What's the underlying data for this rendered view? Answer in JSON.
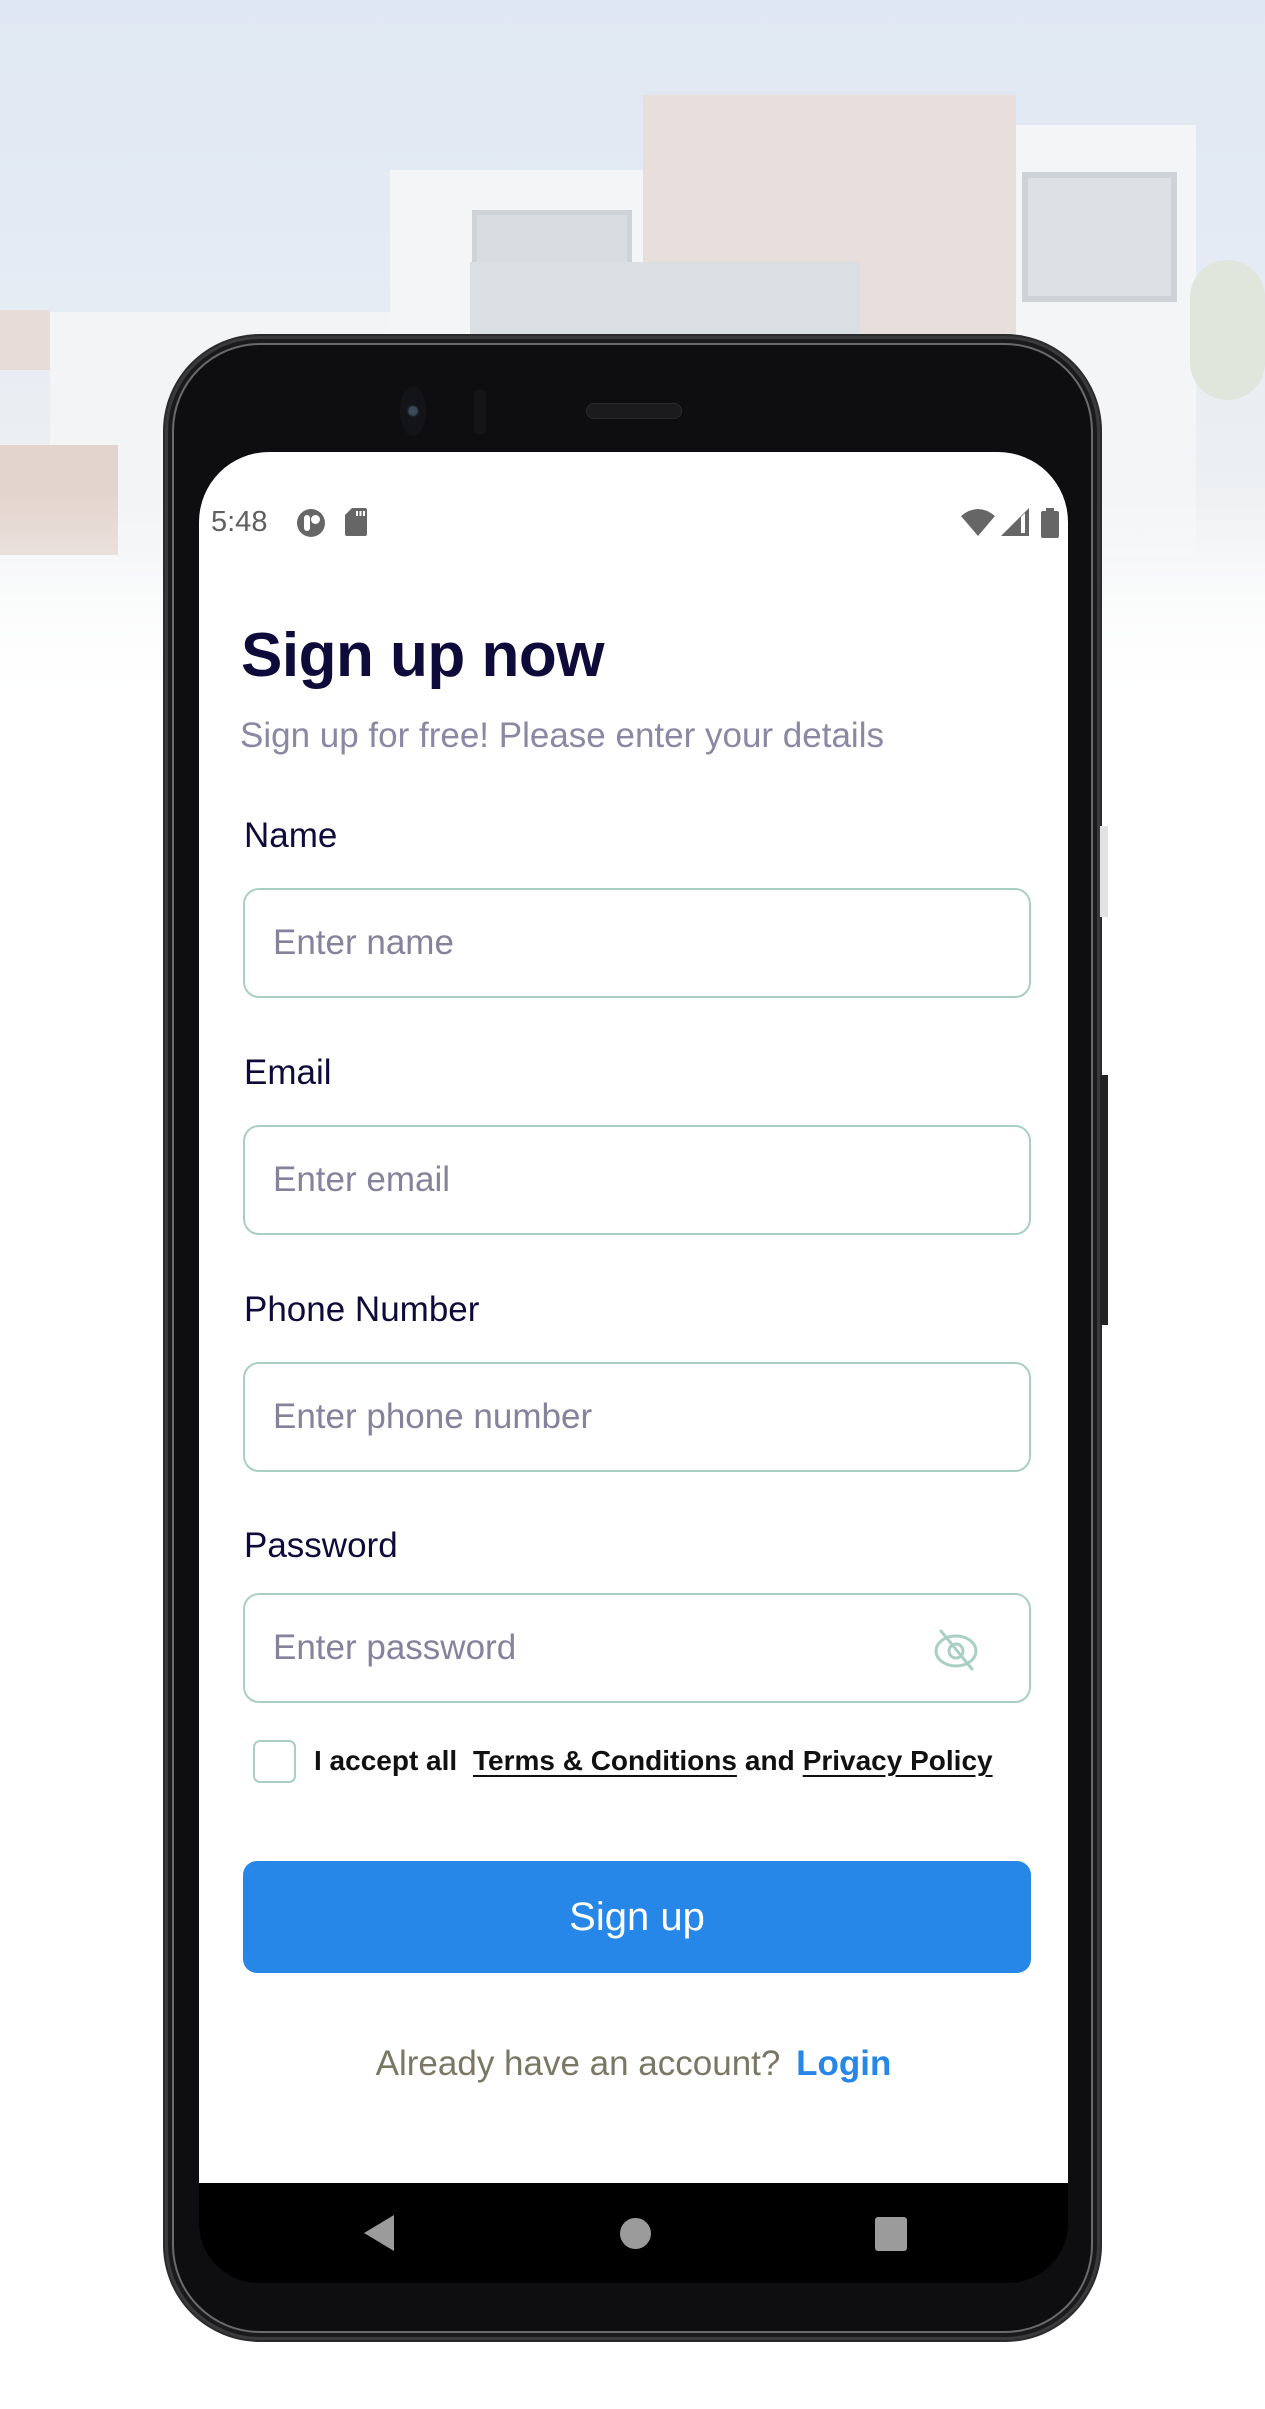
{
  "status_bar": {
    "time": "5:48",
    "left_icons": [
      "data-saver-icon",
      "sd-card-icon"
    ],
    "right_icons": [
      "wifi-icon",
      "cell-signal-icon",
      "battery-icon"
    ]
  },
  "header": {
    "title": "Sign up now",
    "subtitle": "Sign up for free! Please enter your details"
  },
  "form": {
    "fields": [
      {
        "label": "Name",
        "placeholder": "Enter name",
        "value": ""
      },
      {
        "label": "Email",
        "placeholder": "Enter email",
        "value": ""
      },
      {
        "label": "Phone Number",
        "placeholder": "Enter phone number",
        "value": ""
      },
      {
        "label": "Password",
        "placeholder": "Enter password",
        "value": "",
        "toggle_icon": "eye-off-icon"
      }
    ],
    "terms": {
      "checked": false,
      "prefix": "I accept all",
      "terms_link": "Terms & Conditions",
      "conjunction": "and",
      "privacy_link": "Privacy Policy"
    },
    "submit_label": "Sign up"
  },
  "footer": {
    "prompt": "Already have an account?",
    "login_label": "Login"
  },
  "nav_bar": {
    "buttons": [
      "back",
      "home",
      "recents"
    ]
  },
  "colors": {
    "primary": "#2787e8",
    "title": "#0e0a3a",
    "subtitle": "#8a88a3",
    "field_border": "#a9cfc4"
  }
}
